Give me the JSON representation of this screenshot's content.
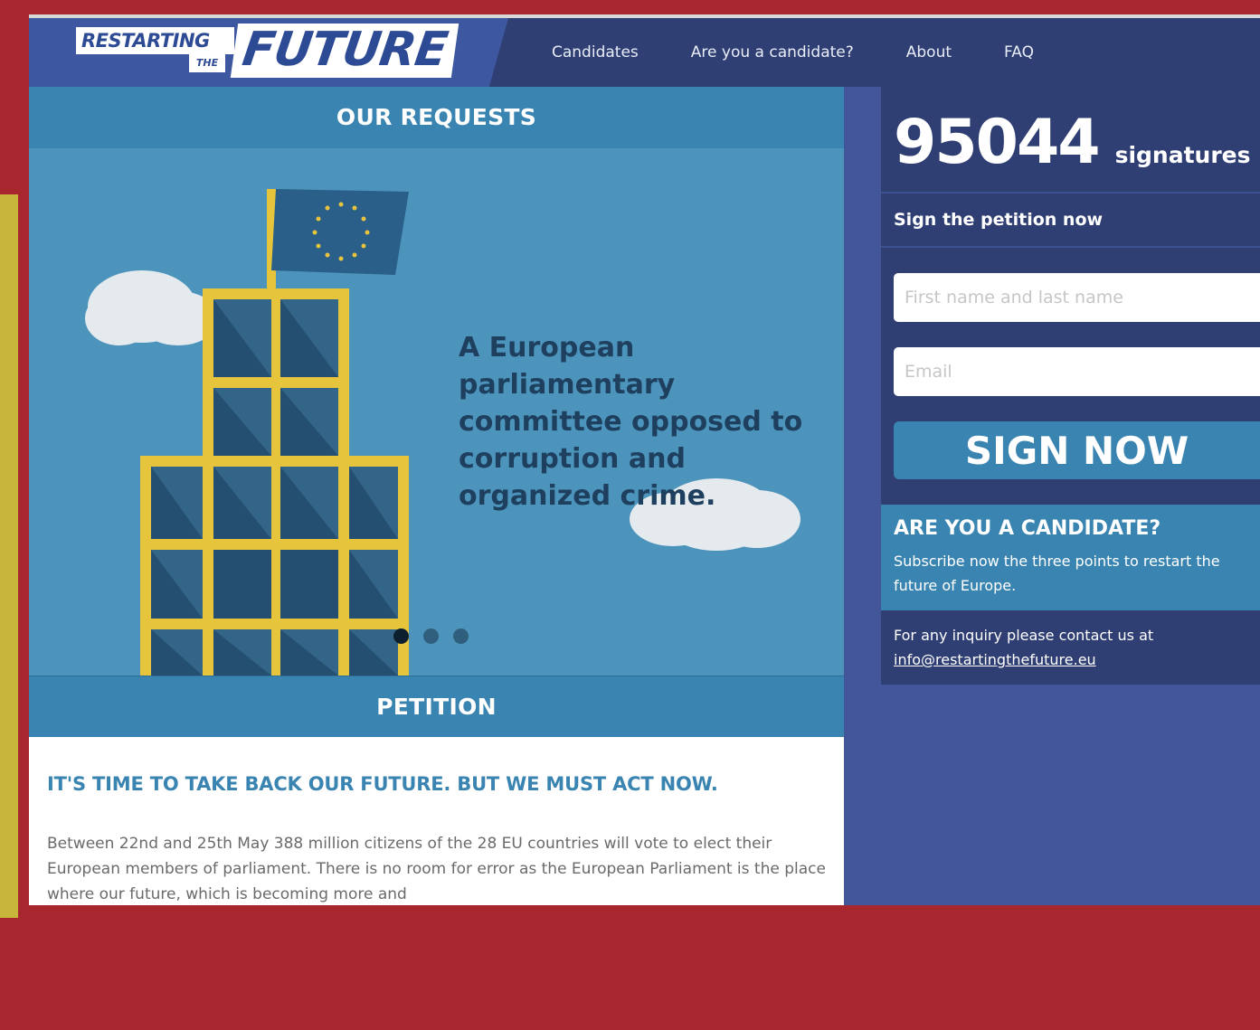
{
  "logo": {
    "top": "RESTARTING",
    "small": "THE",
    "big": "FUTURE"
  },
  "nav": {
    "items": [
      "Candidates",
      "Are you a candidate?",
      "About",
      "FAQ"
    ]
  },
  "requests": {
    "title": "OUR REQUESTS",
    "slide_text": "A European parliamentary committee opposed to corruption and organized crime."
  },
  "petition": {
    "title": "PETITION",
    "heading": "IT'S TIME TO TAKE BACK OUR FUTURE. BUT WE MUST ACT NOW.",
    "body": "Between 22nd and 25th May 388 million citizens of the 28 EU countries will vote to elect their European members of parliament. There is no room for error as the European Parliament is the place where our future, which is becoming more and"
  },
  "sidebar": {
    "count": "95044",
    "count_label": "signatures",
    "sign_title": "Sign the petition now",
    "name_placeholder": "First name and last name",
    "email_placeholder": "Email",
    "sign_button": "SIGN NOW",
    "candidate_title": "ARE YOU A CANDIDATE?",
    "candidate_text": "Subscribe now the three points to restart the future of Europe.",
    "contact_text": "For any inquiry please contact us at",
    "contact_email": "info@restartingthefuture.eu"
  },
  "colors": {
    "background": "#a8262e",
    "navy": "#2f3f73",
    "accent": "#3a84b1",
    "tower_yellow": "#e6c43c"
  }
}
